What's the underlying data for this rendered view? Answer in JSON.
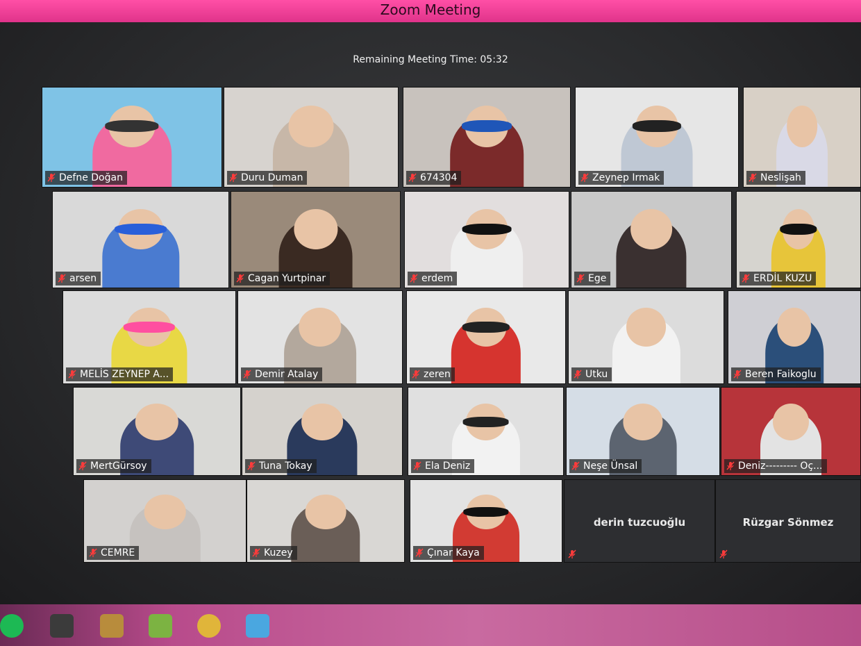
{
  "window": {
    "title": "Zoom Meeting"
  },
  "meeting": {
    "remaining_time": "Remaining Meeting Time: 05:32"
  },
  "participants": [
    {
      "name": "Defne Doğan",
      "bg": "#7fc3e6",
      "shirt": "#f06aa0",
      "glasses": "#333333"
    },
    {
      "name": "Duru Duman",
      "bg": "#d7d3cf",
      "shirt": "#c7b7a8",
      "glasses": ""
    },
    {
      "name": "674304",
      "bg": "#c8c2bd",
      "shirt": "#7b2a2a",
      "glasses": "#1f56b8"
    },
    {
      "name": "Zeynep Irmak",
      "bg": "#e6e6e6",
      "shirt": "#bfc8d4",
      "glasses": "#222222"
    },
    {
      "name": "Neslişah",
      "bg": "#d8d0c6",
      "shirt": "#d9d9e6",
      "glasses": ""
    },
    {
      "name": "arsen",
      "bg": "#d9d9d9",
      "shirt": "#4a7bd0",
      "glasses": "#2a5fd9"
    },
    {
      "name": "Cagan Yurtpinar",
      "bg": "#9a8a7a",
      "shirt": "#3a2a22",
      "glasses": ""
    },
    {
      "name": "erdem",
      "bg": "#e2dede",
      "shirt": "#efefef",
      "glasses": "#111111"
    },
    {
      "name": "Ege",
      "bg": "#c9c9c9",
      "shirt": "#3a3030",
      "glasses": ""
    },
    {
      "name": "ERDİL KUZU",
      "bg": "#d6d4cf",
      "shirt": "#e7c53a",
      "glasses": "#111111"
    },
    {
      "name": "MELİS ZEYNEP A...",
      "bg": "#dcdcdc",
      "shirt": "#e8d845",
      "glasses": "#ff4fa0"
    },
    {
      "name": "Demir Atalay",
      "bg": "#e3e3e3",
      "shirt": "#b3a89d",
      "glasses": ""
    },
    {
      "name": "zeren",
      "bg": "#e9e9e9",
      "shirt": "#d6342f",
      "glasses": "#222222"
    },
    {
      "name": "Utku",
      "bg": "#dcdcdc",
      "shirt": "#f2f2f2",
      "glasses": ""
    },
    {
      "name": "Beren Faikoglu",
      "bg": "#cfcfd4",
      "shirt": "#2b4f7a",
      "glasses": ""
    },
    {
      "name": "MertGürsoy",
      "bg": "#d9d9d6",
      "shirt": "#3e4a77",
      "glasses": ""
    },
    {
      "name": "Tuna Tokay",
      "bg": "#d5d2cd",
      "shirt": "#2a3a5c",
      "glasses": ""
    },
    {
      "name": "Ela Deniz",
      "bg": "#e0e0e0",
      "shirt": "#f2f2f2",
      "glasses": "#222222"
    },
    {
      "name": "Neşe Ünsal",
      "bg": "#d5dde6",
      "shirt": "#5c6470",
      "glasses": ""
    },
    {
      "name": "Deniz--------- Oç...",
      "bg": "#b7343a",
      "shirt": "#e3e3e3",
      "glasses": ""
    },
    {
      "name": "CEMRE",
      "bg": "#d3d1cf",
      "shirt": "#c6c2bf",
      "glasses": ""
    },
    {
      "name": "Kuzey",
      "bg": "#d9d7d4",
      "shirt": "#6a5e57",
      "glasses": ""
    },
    {
      "name": "Çınar Kaya",
      "bg": "#e3e3e3",
      "shirt": "#d23b33",
      "glasses": "#111111"
    }
  ],
  "camera_off": [
    {
      "name": "derin tuzcuoğlu"
    },
    {
      "name": "Rüzgar Sönmez"
    }
  ],
  "taskbar": {
    "icons": [
      {
        "name": "spotify-icon",
        "color": "#1db954"
      },
      {
        "name": "app-icon",
        "color": "#3b3b3b"
      },
      {
        "name": "file-icon",
        "color": "#b88c3c"
      },
      {
        "name": "app-icon",
        "color": "#7cb342"
      },
      {
        "name": "chrome-icon",
        "color": "#e0b53a"
      },
      {
        "name": "zoom-icon",
        "color": "#4aa7e0"
      }
    ]
  }
}
